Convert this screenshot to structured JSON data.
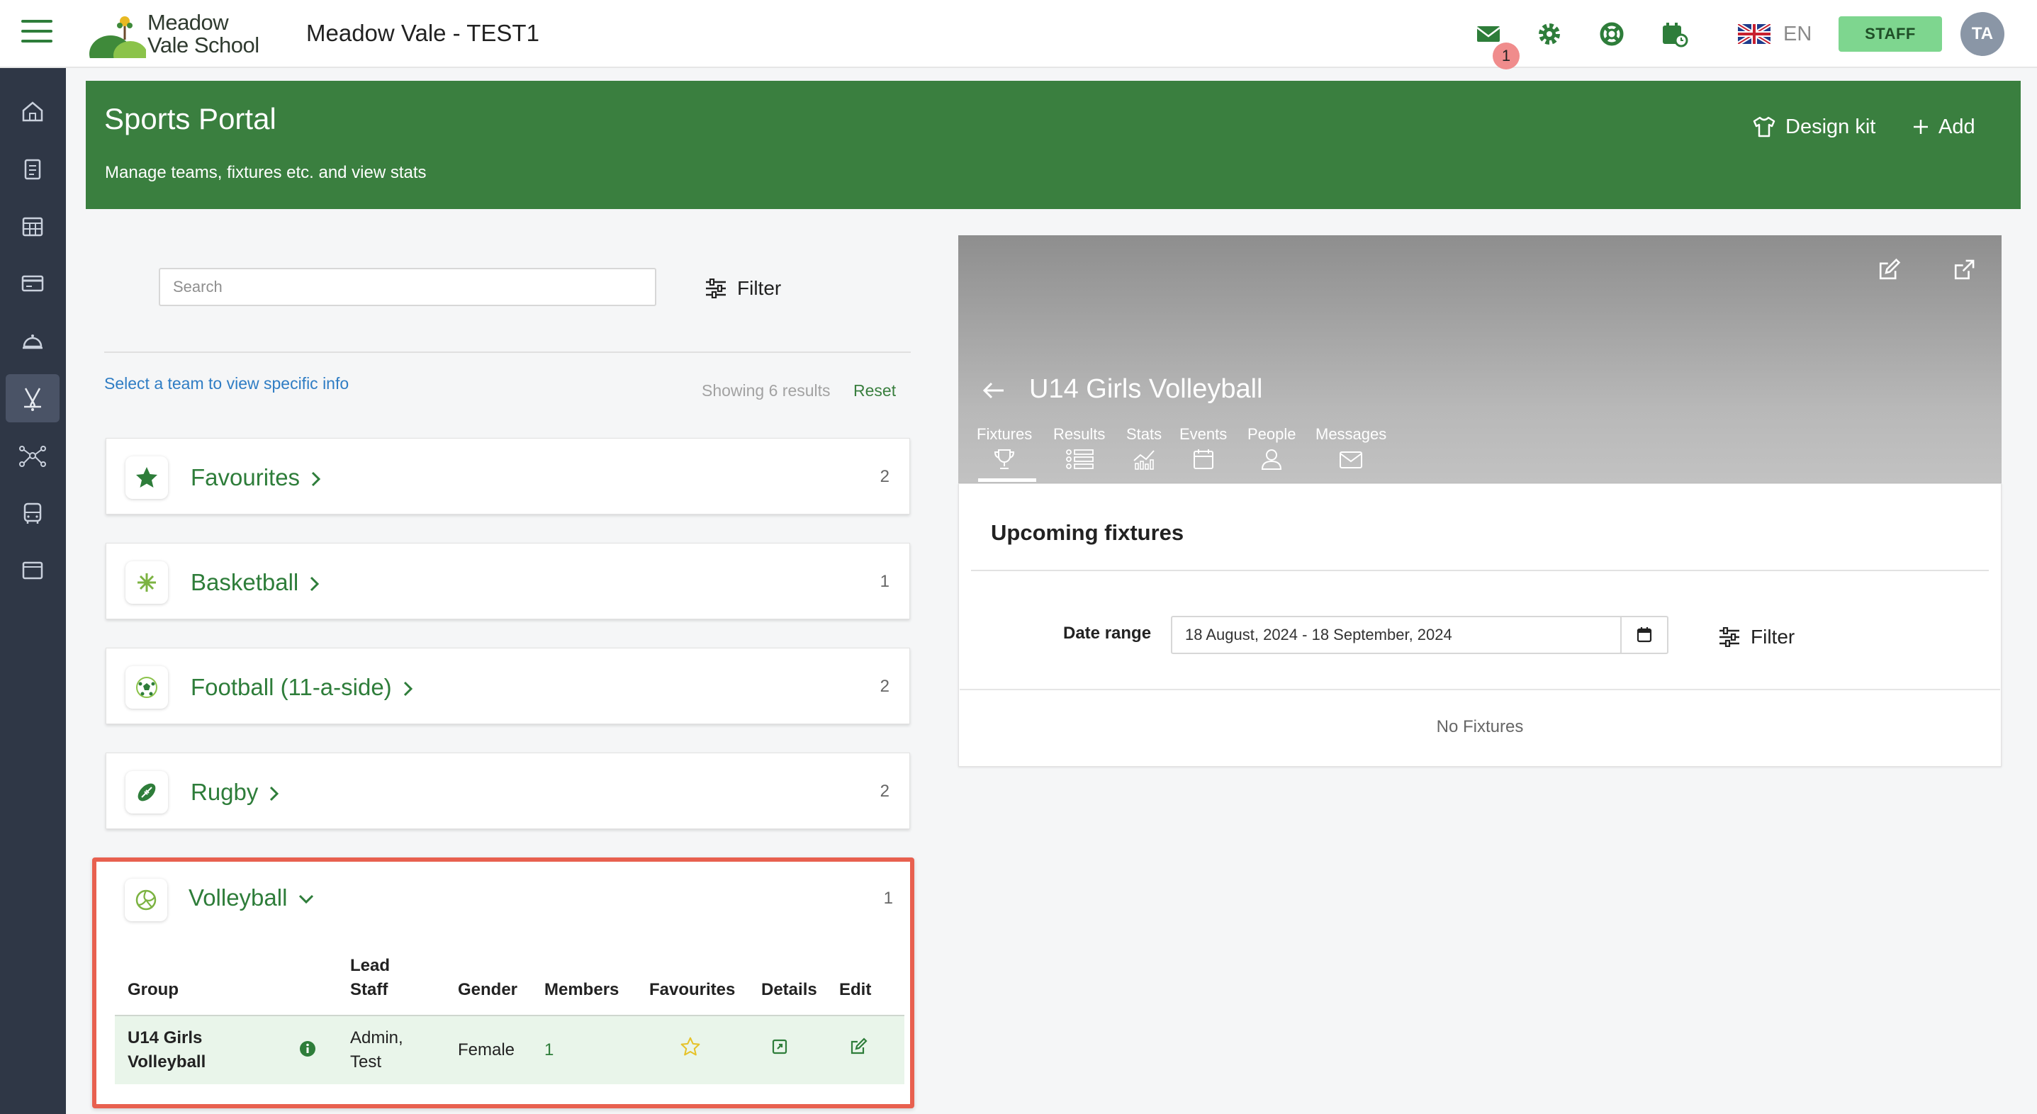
{
  "header": {
    "logo_line1": "Meadow",
    "logo_line2": "Vale School",
    "app_title": "Meadow Vale - TEST1",
    "messages_badge": "1",
    "language": "EN",
    "role_button": "STAFF",
    "avatar_initials": "TA"
  },
  "banner": {
    "title": "Sports Portal",
    "subtitle": "Manage teams, fixtures etc. and view stats",
    "design_kit_label": "Design kit",
    "add_label": "Add"
  },
  "left": {
    "search_placeholder": "Search",
    "filter_label": "Filter",
    "select_hint": "Select a team to view specific info",
    "showing": "Showing 6 results",
    "reset": "Reset",
    "sports": [
      {
        "name": "Favourites",
        "count": "2",
        "icon": "star-icon"
      },
      {
        "name": "Basketball",
        "count": "1",
        "icon": "basketball-icon"
      },
      {
        "name": "Football (11-a-side)",
        "count": "2",
        "icon": "football-icon"
      },
      {
        "name": "Rugby",
        "count": "2",
        "icon": "rugby-icon"
      },
      {
        "name": "Volleyball",
        "count": "1",
        "icon": "volleyball-icon"
      }
    ],
    "volleyball_table": {
      "headers": {
        "group": "Group",
        "lead_staff_1": "Lead",
        "lead_staff_2": "Staff",
        "gender": "Gender",
        "members": "Members",
        "favourites": "Favourites",
        "details": "Details",
        "edit": "Edit"
      },
      "row": {
        "group_1": "U14 Girls",
        "group_2": "Volleyball",
        "lead_staff_1": "Admin,",
        "lead_staff_2": "Test",
        "gender": "Female",
        "members": "1"
      }
    }
  },
  "right": {
    "team_title": "U14 Girls Volleyball",
    "tabs": [
      "Fixtures",
      "Results",
      "Stats",
      "Events",
      "People",
      "Messages"
    ],
    "upcoming_title": "Upcoming fixtures",
    "date_range_label": "Date range",
    "date_range_value": "18 August, 2024 - 18 September, 2024",
    "filter_label": "Filter",
    "no_fixtures": "No Fixtures"
  },
  "colors": {
    "brand_green": "#3a7f3f",
    "sidebar": "#2f3746",
    "staff_button": "#7ed68f",
    "highlight_border": "#e8604f",
    "link_blue": "#2f7dc4"
  }
}
